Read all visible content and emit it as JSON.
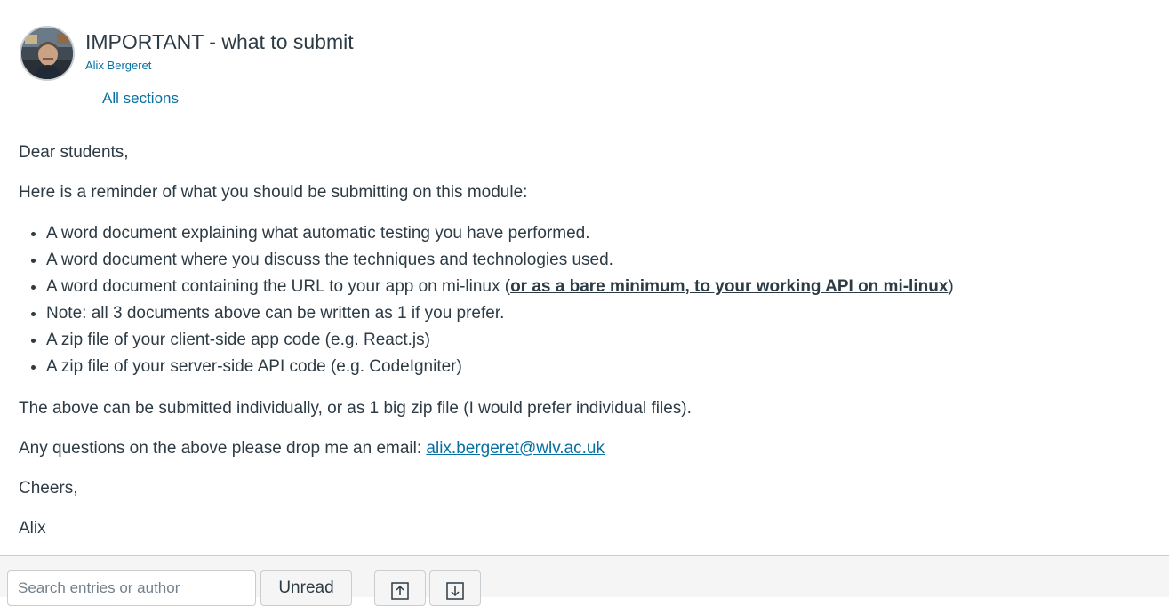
{
  "post": {
    "title": "IMPORTANT - what to submit",
    "author": "Alix Bergeret",
    "sections": "All sections"
  },
  "message": {
    "greeting": "Dear students,",
    "intro": "Here is a reminder of what you should be submitting on this module:",
    "items": [
      "A word document explaining what automatic testing you have performed.",
      "A word document where you discuss the techniques and technologies used.",
      "A word document containing the URL to your app on mi-linux (",
      "Note: all 3 documents above can be written as 1 if you prefer.",
      "A zip file of your client-side app code (e.g. React.js)",
      "A zip file of your server-side API code (e.g. CodeIgniter)"
    ],
    "item3_bold": "or as a bare minimum, to your working API on mi-linux",
    "item3_end": ")",
    "note": "The above can be submitted individually, or as 1 big zip file (I would prefer individual files).",
    "questions": "Any questions on the above please drop me an email: ",
    "email": "alix.bergeret@wlv.ac.uk",
    "signoff": "Cheers,",
    "signature": "Alix"
  },
  "toolbar": {
    "search_placeholder": "Search entries or author",
    "unread_label": "Unread",
    "up_icon": "arrow-up-icon",
    "down_icon": "arrow-down-icon"
  },
  "colors": {
    "link": "#0770a3",
    "text": "#2d3b45",
    "border": "#c7cdd1",
    "toolbar_bg": "#f5f5f5"
  }
}
